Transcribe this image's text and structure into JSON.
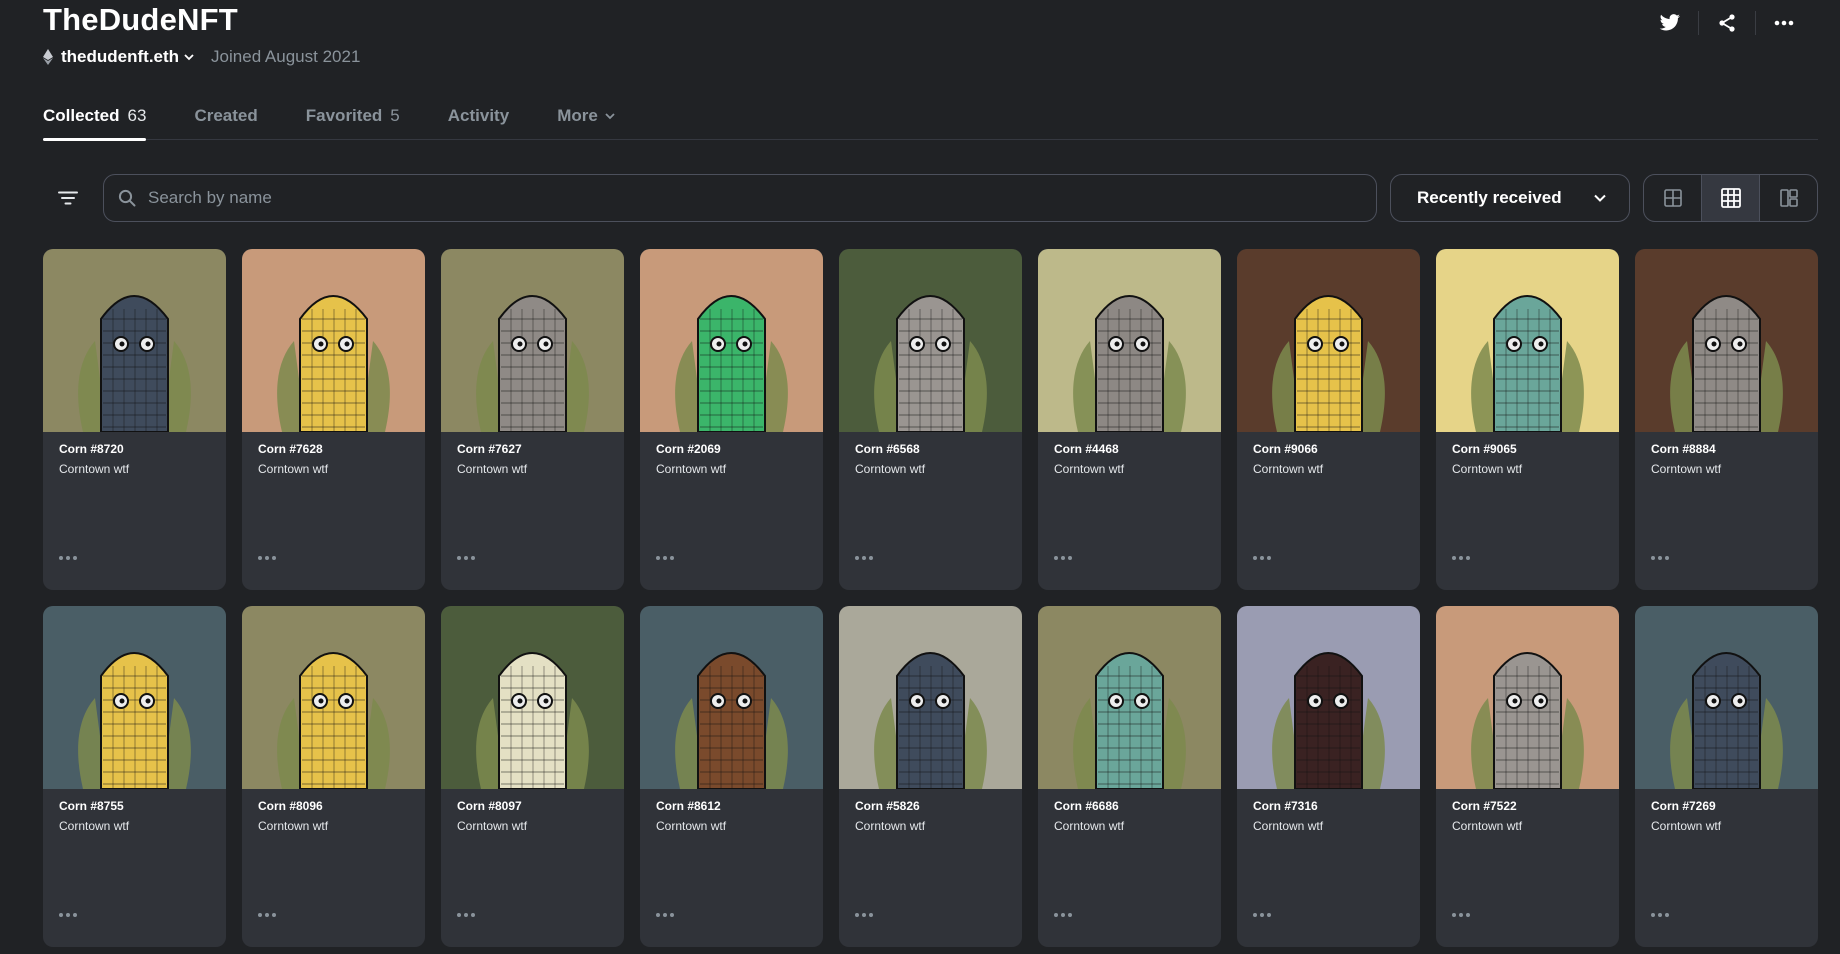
{
  "profile": {
    "title": "TheDudeNFT",
    "wallet": "thedudenft.eth",
    "joined": "Joined August 2021"
  },
  "header_icons": [
    "twitter-icon",
    "share-icon",
    "more-icon"
  ],
  "tabs": [
    {
      "label": "Collected",
      "count": "63",
      "active": true
    },
    {
      "label": "Created",
      "count": "",
      "active": false
    },
    {
      "label": "Favorited",
      "count": "5",
      "active": false
    },
    {
      "label": "Activity",
      "count": "",
      "active": false
    },
    {
      "label": "More",
      "count": "",
      "active": false,
      "dropdown": true
    }
  ],
  "toolbar": {
    "search_placeholder": "Search by name",
    "sort_label": "Recently received",
    "views": [
      "large-grid-icon",
      "small-grid-icon",
      "list-icon"
    ],
    "active_view": 1
  },
  "colors": {
    "background": "#202225",
    "card": "#303339",
    "border": "#4c505c",
    "muted": "#8a939b"
  },
  "items": [
    {
      "name": "Corn #8720",
      "collection": "Corntown wtf",
      "bg": "#8c8862",
      "kernel": "#3f4b5c"
    },
    {
      "name": "Corn #7628",
      "collection": "Corntown wtf",
      "bg": "#c89a7a",
      "kernel": "#e6c24a"
    },
    {
      "name": "Corn #7627",
      "collection": "Corntown wtf",
      "bg": "#8c8862",
      "kernel": "#8f8a86"
    },
    {
      "name": "Corn #2069",
      "collection": "Corntown wtf",
      "bg": "#c89a7a",
      "kernel": "#3bb56a"
    },
    {
      "name": "Corn #6568",
      "collection": "Corntown wtf",
      "bg": "#4c5c3c",
      "kernel": "#9a9591"
    },
    {
      "name": "Corn #4468",
      "collection": "Corntown wtf",
      "bg": "#bdb98a",
      "kernel": "#8d8884"
    },
    {
      "name": "Corn #9066",
      "collection": "Corntown wtf",
      "bg": "#5a3c2c",
      "kernel": "#e6c24a"
    },
    {
      "name": "Corn #9065",
      "collection": "Corntown wtf",
      "bg": "#e6d488",
      "kernel": "#6aa69a"
    },
    {
      "name": "Corn #8884",
      "collection": "Corntown wtf",
      "bg": "#5a3c2c",
      "kernel": "#8f8a86"
    },
    {
      "name": "Corn #8755",
      "collection": "Corntown wtf",
      "bg": "#4a5e66",
      "kernel": "#e6c24a"
    },
    {
      "name": "Corn #8096",
      "collection": "Corntown wtf",
      "bg": "#8c8862",
      "kernel": "#e6c24a"
    },
    {
      "name": "Corn #8097",
      "collection": "Corntown wtf",
      "bg": "#4c5c3c",
      "kernel": "#e4e0c4"
    },
    {
      "name": "Corn #8612",
      "collection": "Corntown wtf",
      "bg": "#4a5e66",
      "kernel": "#7a4a2c"
    },
    {
      "name": "Corn #5826",
      "collection": "Corntown wtf",
      "bg": "#aaa89a",
      "kernel": "#3f4b5c"
    },
    {
      "name": "Corn #6686",
      "collection": "Corntown wtf",
      "bg": "#8c8862",
      "kernel": "#6aa69a"
    },
    {
      "name": "Corn #7316",
      "collection": "Corntown wtf",
      "bg": "#9a9cb2",
      "kernel": "#3a2222"
    },
    {
      "name": "Corn #7522",
      "collection": "Corntown wtf",
      "bg": "#c89a7a",
      "kernel": "#9a9591"
    },
    {
      "name": "Corn #7269",
      "collection": "Corntown wtf",
      "bg": "#4a5e66",
      "kernel": "#3f4b5c"
    }
  ]
}
